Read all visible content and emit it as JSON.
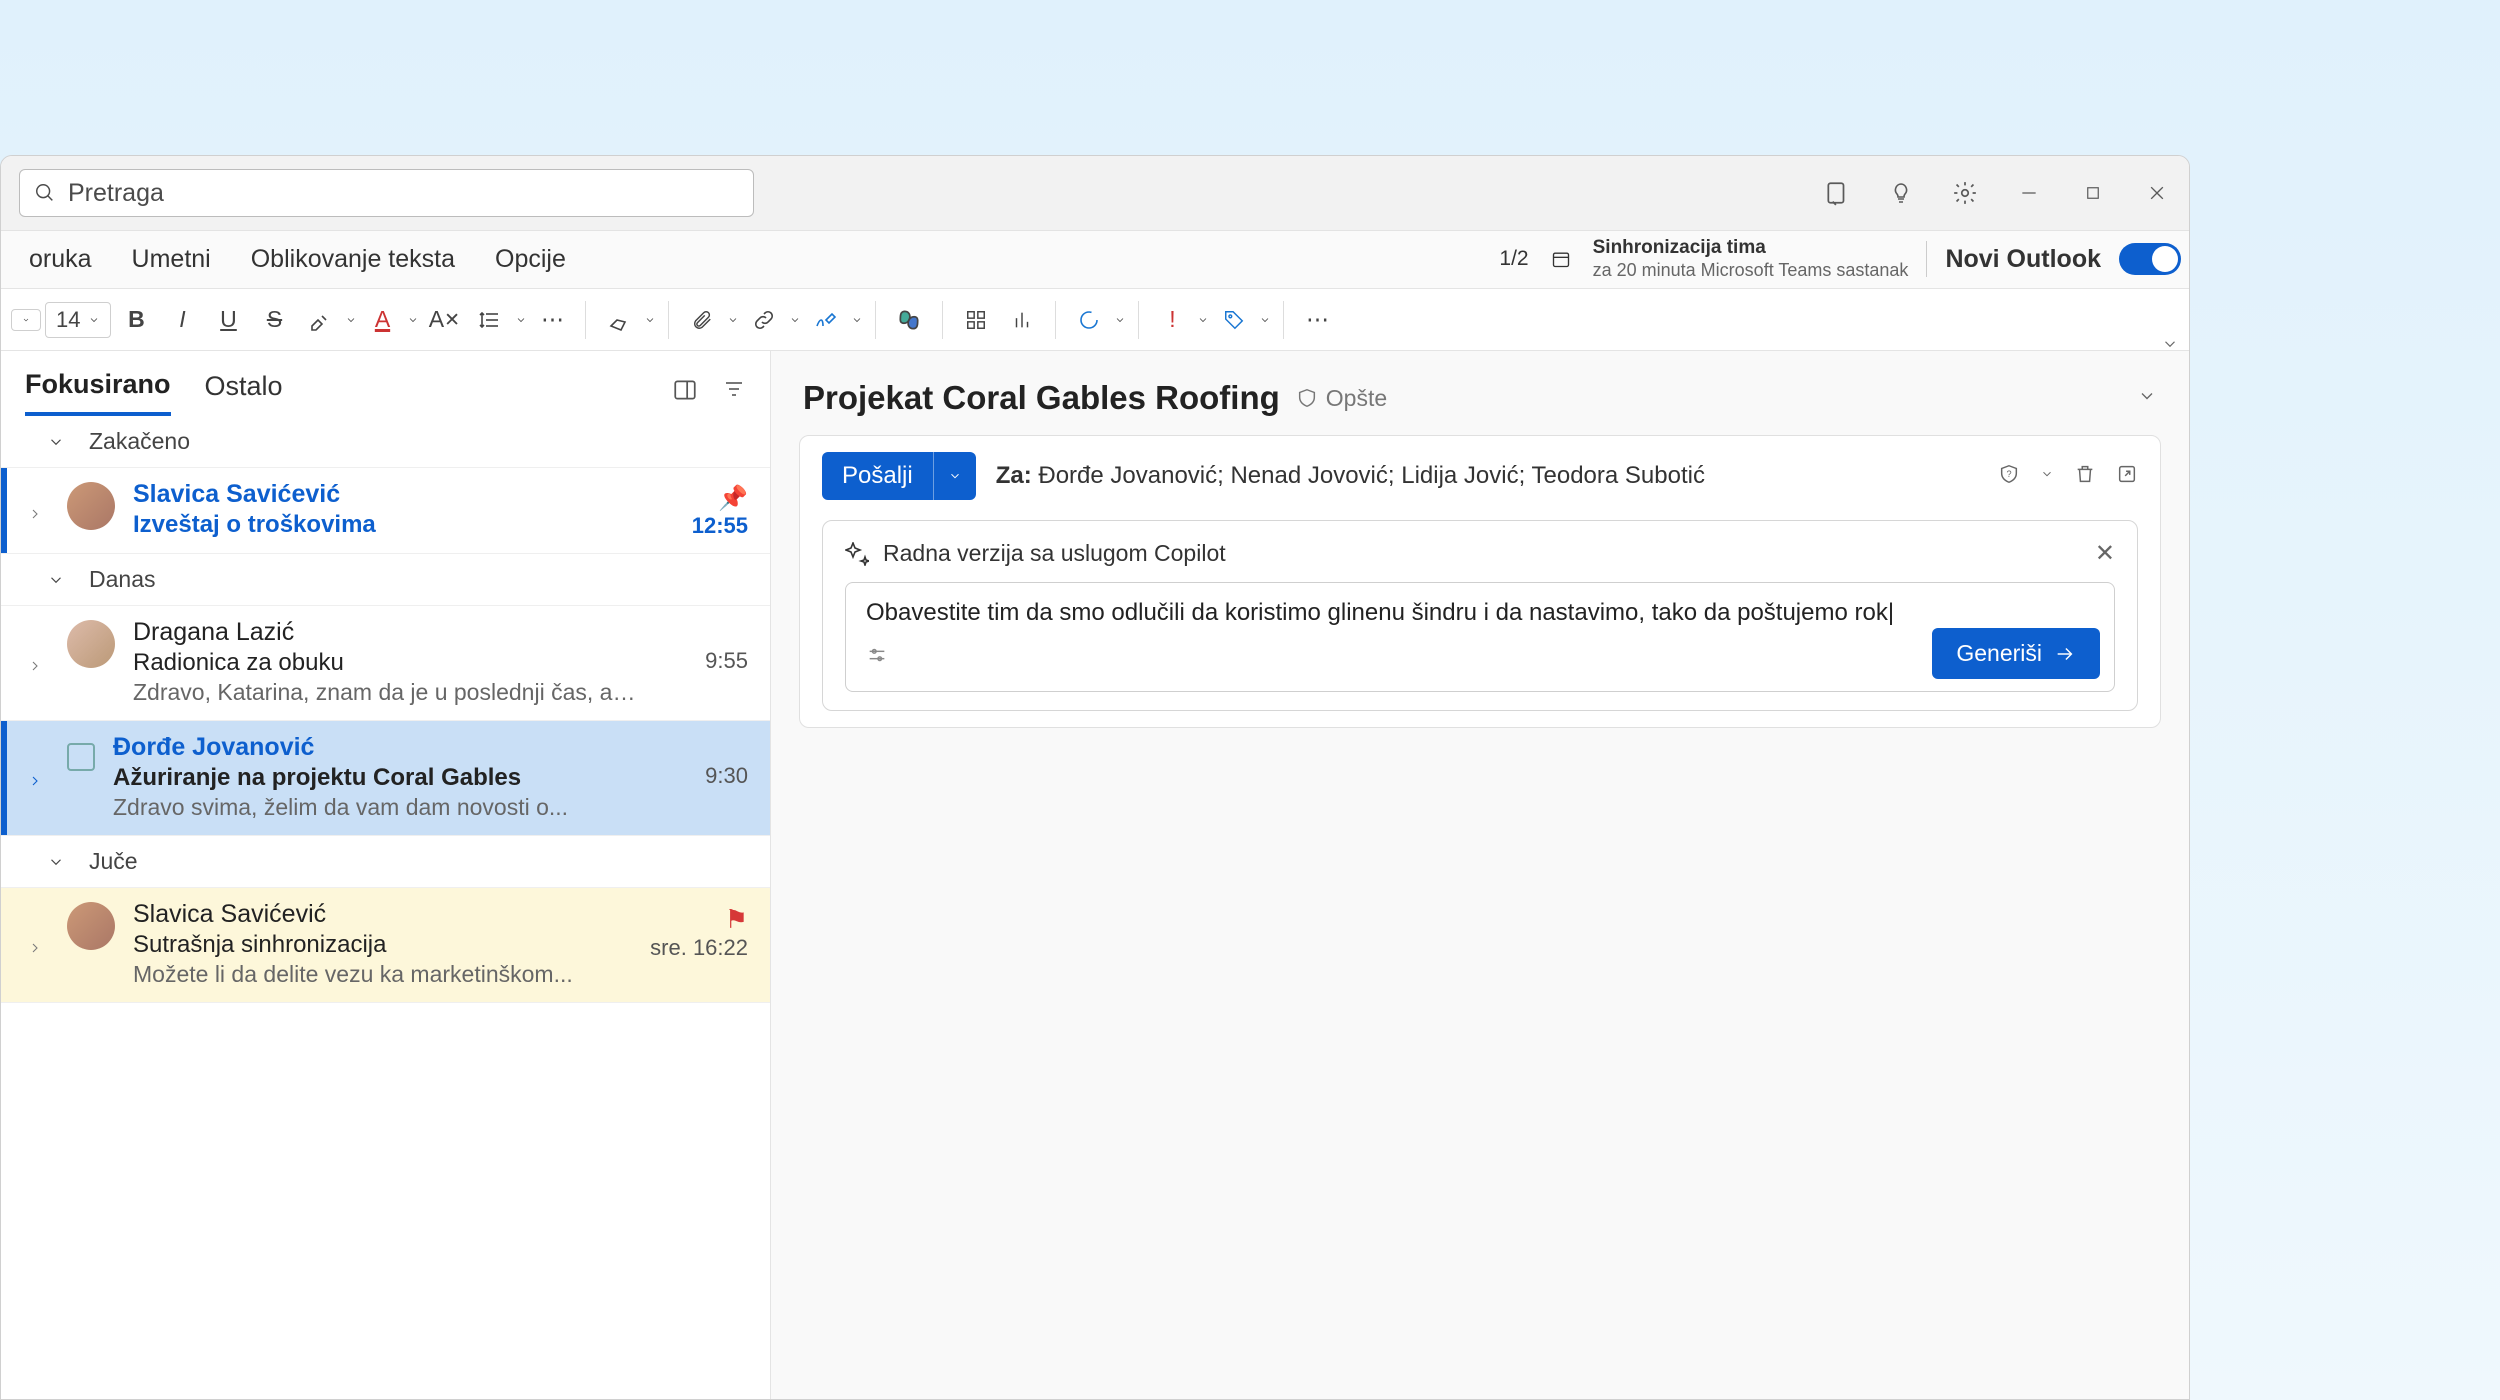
{
  "search": {
    "placeholder": "Pretraga"
  },
  "ribbon": {
    "tabs": [
      "oruka",
      "Umetni",
      "Oblikovanje teksta",
      "Opcije"
    ],
    "page": "1/2",
    "meeting": {
      "title": "Sinhronizacija tima",
      "sub": "za 20 minuta Microsoft Teams sastanak"
    },
    "toggle_label": "Novi Outlook",
    "font_size": "14"
  },
  "list": {
    "tabs": {
      "focused": "Fokusirano",
      "other": "Ostalo"
    },
    "groups": {
      "pinned": "Zakačeno",
      "today": "Danas",
      "yesterday": "Juče"
    },
    "items": [
      {
        "sender": "Slavica Savićević",
        "subject": "Izveštaj o troškovima",
        "time": "12:55"
      },
      {
        "sender": "Dragana Lazić",
        "subject": "Radionica za obuku",
        "preview": "Zdravo, Katarina, znam da je u poslednji čas, ali...",
        "time": "9:55"
      },
      {
        "sender": "Đorđe Jovanović",
        "subject": "Ažuriranje na projektu Coral Gables",
        "preview": "Zdravo svima, želim da vam dam novosti o...",
        "time": "9:30"
      },
      {
        "sender": "Slavica Savićević",
        "subject": "Sutrašnja sinhronizacija",
        "preview": "Možete li da delite vezu ka marketinškom...",
        "time": "sre. 16:22"
      }
    ]
  },
  "reader": {
    "title": "Projekat Coral Gables Roofing",
    "tag": "Opšte",
    "send": "Pošalji",
    "to_label": "Za:",
    "to": "Đorđe Jovanović; Nenad Jovović; Lidija Jović; Teodora Subotić",
    "copilot": {
      "header": "Radna verzija sa uslugom Copilot",
      "prompt": "Obavestite tim da smo odlučili da koristimo glinenu šindru i da nastavimo, tako da poštujemo rok",
      "generate": "Generiši"
    }
  }
}
